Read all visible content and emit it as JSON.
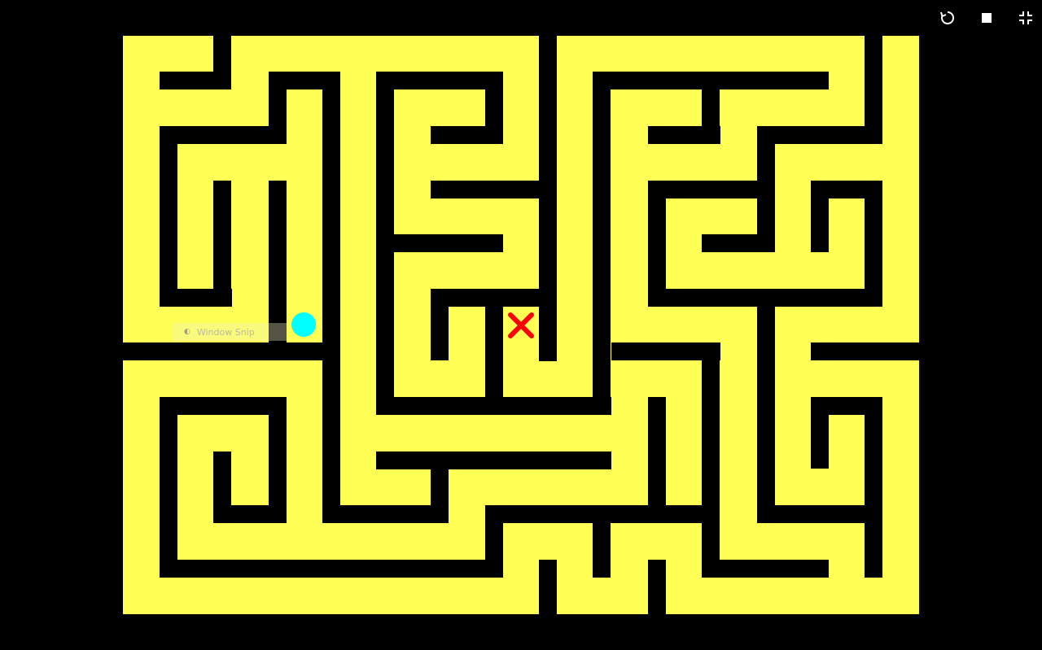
{
  "toolbar": {
    "restart_icon": "restart-icon",
    "stop_icon": "stop-icon",
    "exit_fullscreen_icon": "exit-fullscreen-icon"
  },
  "colors": {
    "background": "#000000",
    "path": "#ffff55",
    "wall": "#000000",
    "player": "#00ffff",
    "goal": "#ff0000",
    "toolbar_icon": "#ffffff"
  },
  "maze": {
    "player_icon": "cyan-circle",
    "goal_icon": "red-x"
  },
  "overlay": {
    "snip_label": "Window Snip",
    "snip_icon": "◐"
  }
}
